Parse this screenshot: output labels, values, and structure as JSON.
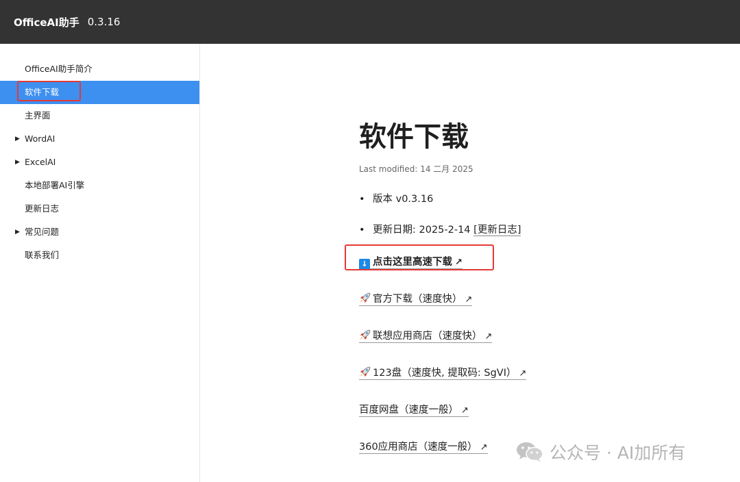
{
  "header": {
    "app_name": "OfficeAI助手",
    "version": "0.3.16"
  },
  "sidebar": {
    "items": [
      {
        "label": "OfficeAI助手简介",
        "expandable": false
      },
      {
        "label": "软件下载",
        "expandable": false,
        "active": true
      },
      {
        "label": "主界面",
        "expandable": false
      },
      {
        "label": "WordAI",
        "expandable": true
      },
      {
        "label": "ExcelAI",
        "expandable": true
      },
      {
        "label": "本地部署AI引擎",
        "expandable": false
      },
      {
        "label": "更新日志",
        "expandable": false
      },
      {
        "label": "常见问题",
        "expandable": true
      },
      {
        "label": "联系我们",
        "expandable": false
      }
    ]
  },
  "main": {
    "title": "软件下载",
    "last_modified": "Last modified: 14 二月 2025",
    "bullet_1": "版本 v0.3.16",
    "bullet_2_prefix": "更新日期: 2025-2-14 ",
    "bullet_2_link": "[更新日志]",
    "links": {
      "fast_download": "点击这里高速下载",
      "official": "官方下载（速度快）",
      "lenovo": "联想应用商店（速度快）",
      "pan123": "123盘（速度快, 提取码: SgVI）",
      "baidu": "百度网盘（速度一般）",
      "store360": "360应用商店（速度一般）"
    },
    "external_arrow": "↗",
    "download_icon_glyph": "↓"
  },
  "watermark": {
    "text": "公众号 · AI加所有"
  },
  "colors": {
    "header_bg": "#333333",
    "active_bg": "#3d8ff0",
    "highlight_border": "#e53935"
  },
  "icons": {
    "download": "download-box-icon",
    "rocket": "rocket-icon",
    "external": "external-link-icon",
    "wechat": "wechat-icon",
    "caret": "caret-right-icon"
  }
}
